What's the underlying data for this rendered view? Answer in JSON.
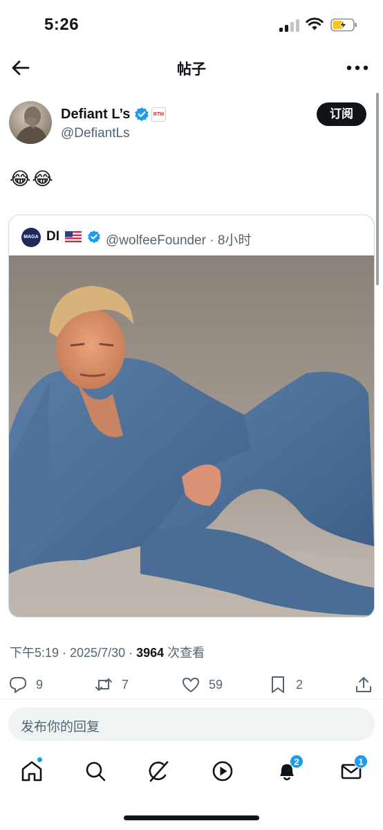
{
  "status_bar": {
    "time": "5:26"
  },
  "nav": {
    "title": "帖子",
    "back_icon": "arrow-left-icon",
    "more_icon": "more-horizontal-icon"
  },
  "author": {
    "name": "Defiant L’s",
    "handle": "@DefiantLs",
    "badge_text": "RTM",
    "subscribe_label": "订阅"
  },
  "tweet": {
    "text": "😂😂"
  },
  "quote": {
    "name": "DI",
    "avatar_text": "MAGA",
    "handle_time": "@wolfeeFounder · 8小时",
    "media": "photo-man-in-denim-outfit"
  },
  "meta": {
    "time_date": "下午5:19 · 2025/7/30 · ",
    "views": "3964",
    "views_label": " 次查看"
  },
  "actions": {
    "replies": "9",
    "reposts": "7",
    "likes": "59",
    "bookmarks": "2"
  },
  "reply_box": {
    "placeholder": "发布你的回复"
  },
  "tabbar": {
    "items": [
      "home-icon",
      "search-icon",
      "grok-icon",
      "video-icon",
      "notifications-icon",
      "messages-icon"
    ],
    "notifications_badge": "2",
    "messages_badge": "1"
  },
  "colors": {
    "accent": "#1d9bf0",
    "text": "#0f1419",
    "secondary": "#536471",
    "border": "#cfd9de"
  }
}
